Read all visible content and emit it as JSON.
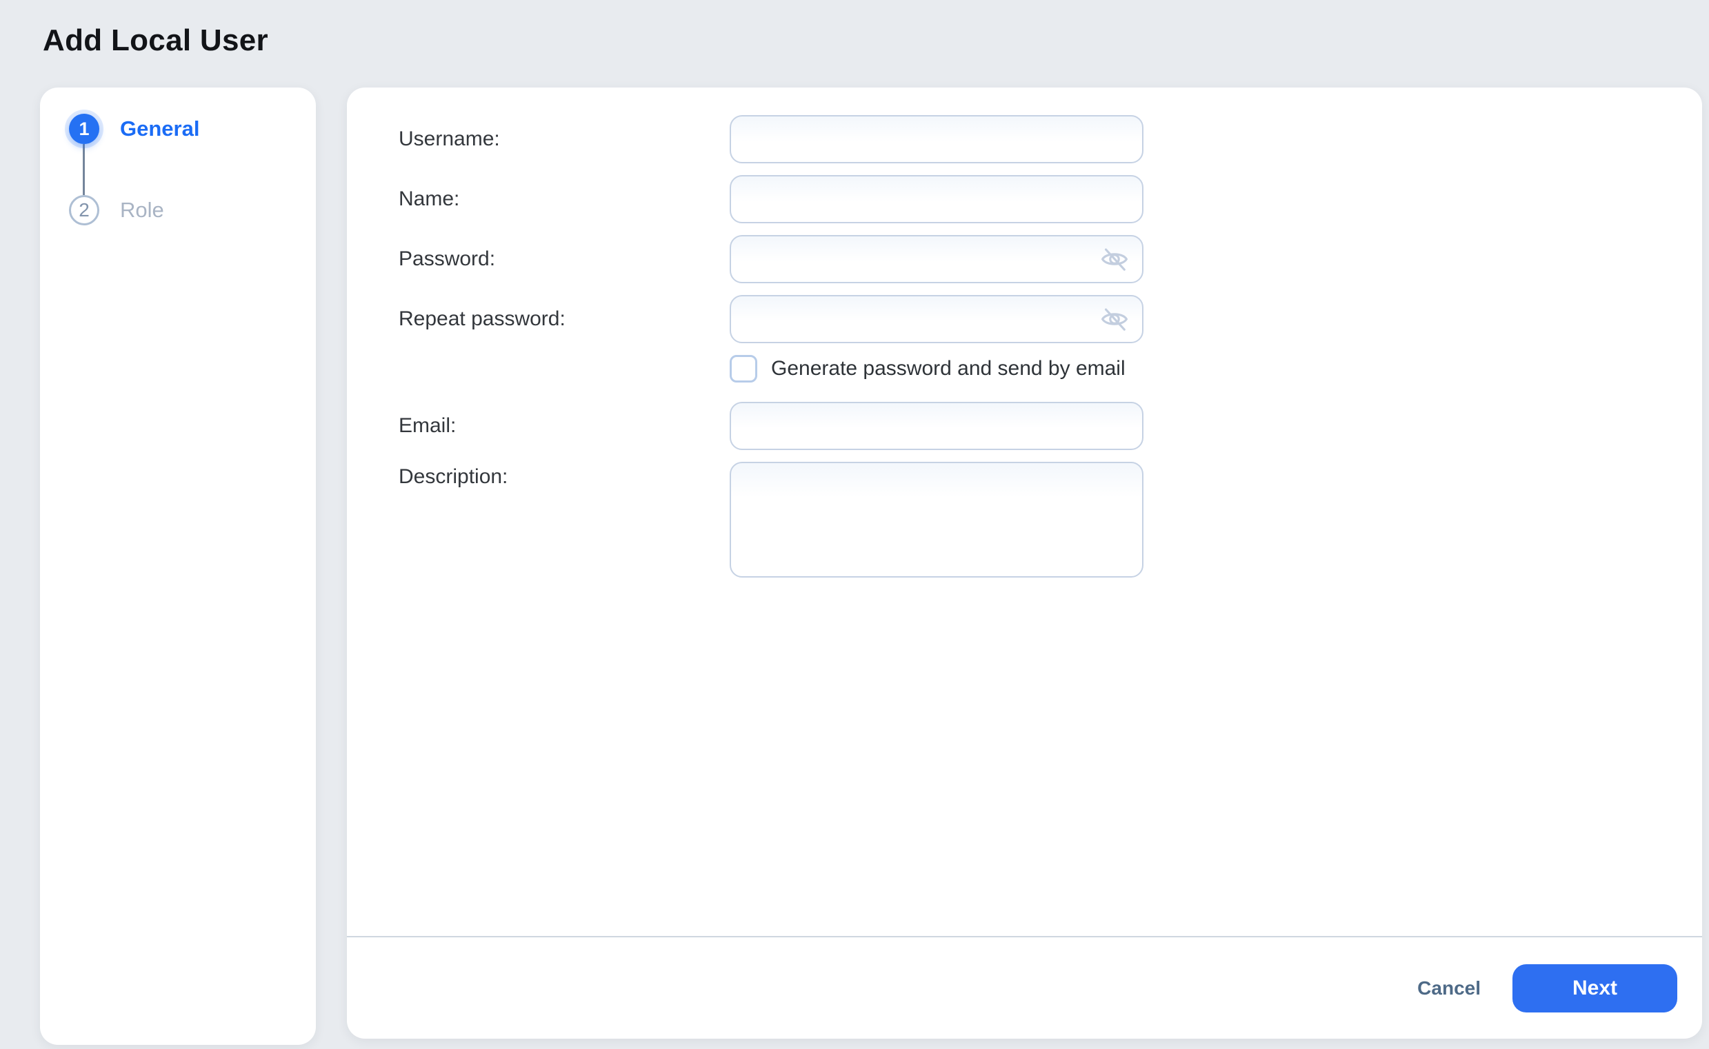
{
  "page": {
    "title": "Add Local User",
    "background_color": "#e8ebef",
    "accent_color": "#2571f3"
  },
  "wizard": {
    "steps": [
      {
        "number": "1",
        "label": "General",
        "state": "active"
      },
      {
        "number": "2",
        "label": "Role",
        "state": "upcoming"
      }
    ]
  },
  "form": {
    "fields": {
      "username": {
        "label": "Username:",
        "value": "",
        "placeholder": ""
      },
      "name": {
        "label": "Name:",
        "value": "",
        "placeholder": ""
      },
      "password": {
        "label": "Password:",
        "value": "",
        "placeholder": "",
        "icon": "eye-off-icon"
      },
      "repeat_password": {
        "label": "Repeat password:",
        "value": "",
        "placeholder": "",
        "icon": "eye-off-icon"
      },
      "email": {
        "label": "Email:",
        "value": "",
        "placeholder": ""
      },
      "description": {
        "label": "Description:",
        "value": "",
        "placeholder": ""
      }
    },
    "generate_checkbox": {
      "label": "Generate password and send by email",
      "checked": false
    }
  },
  "footer": {
    "cancel_label": "Cancel",
    "next_label": "Next"
  },
  "colors": {
    "input_border": "#c6d2e4",
    "divider": "#cfd7e0",
    "cancel_text": "#4e6a87",
    "inactive_step_text": "#a9b4c4",
    "eye_icon": "#c3cedf"
  }
}
